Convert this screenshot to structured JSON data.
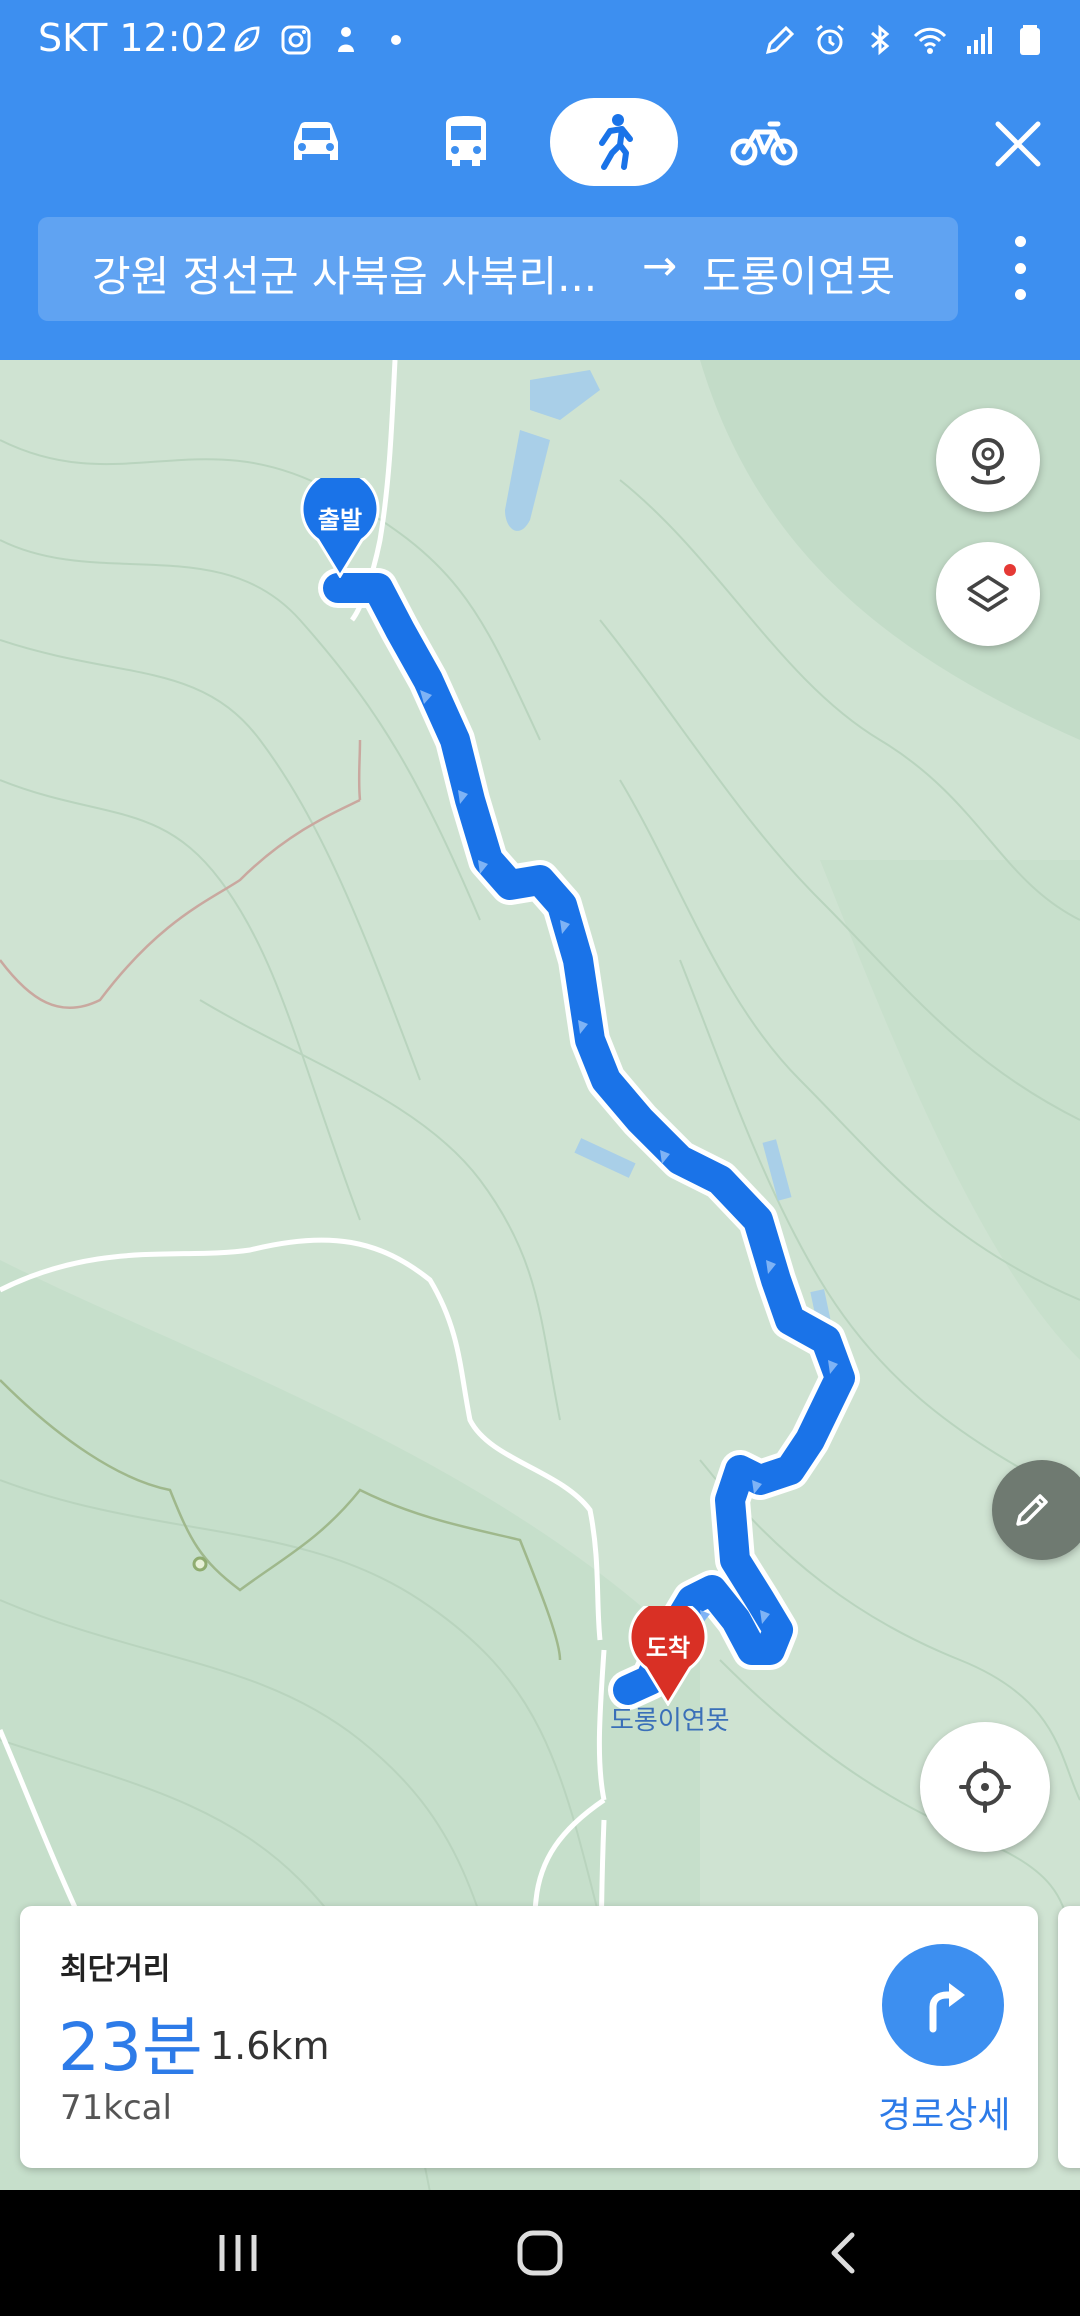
{
  "status_bar": {
    "carrier_time": "SKT 12:02",
    "left_icons": [
      "leaf-notification-icon",
      "instagram-icon",
      "app-notification-icon",
      "more-dot-icon"
    ],
    "right_icons": [
      "pen-icon",
      "alarm-icon",
      "bluetooth-icon",
      "wifi-icon",
      "signal-icon",
      "battery-icon"
    ]
  },
  "transport_modes": [
    {
      "icon": "car-icon",
      "active": false
    },
    {
      "icon": "bus-icon",
      "active": false
    },
    {
      "icon": "walk-icon",
      "active": true
    },
    {
      "icon": "bike-icon",
      "active": false
    }
  ],
  "route": {
    "origin": "강원 정선군 사북읍 사북리...",
    "arrow": "→",
    "destination": "도롱이연못"
  },
  "map": {
    "start_marker_label": "출발",
    "end_marker_label": "도착",
    "destination_place_label": "도롱이연못",
    "route_color": "#1a73e8",
    "start_marker_color": "#1a73e8",
    "end_marker_color": "#d93025"
  },
  "route_card": {
    "label": "최단거리",
    "time": "23분",
    "distance": "1.6km",
    "calories": "71kcal",
    "detail_button": "경로상세"
  },
  "colors": {
    "header": "#3d8ff0",
    "map_background": "#cfe3d2",
    "accent": "#2d7be8"
  }
}
